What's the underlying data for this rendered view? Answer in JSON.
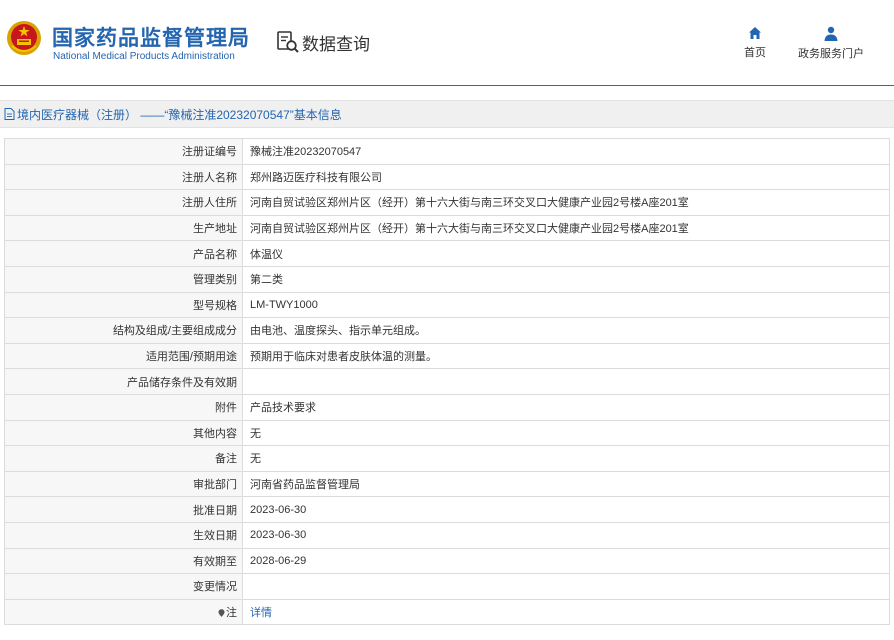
{
  "header": {
    "brand_cn": "国家药品监督管理局",
    "brand_en": "National Medical Products Administration",
    "query_label": "数据查询",
    "emblem_icon": "national-emblem-icon",
    "accent": "#2465b0",
    "nav": [
      {
        "label": "首页",
        "icon": "home-icon"
      },
      {
        "label": "政务服务门户",
        "icon": "user-icon"
      }
    ]
  },
  "title_bar": {
    "text": "境内医疗器械（注册） ——“豫械注准20232070547”基本信息"
  },
  "fields": [
    {
      "key": "注册证编号",
      "value": "豫械注准20232070547"
    },
    {
      "key": "注册人名称",
      "value": "郑州路迈医疗科技有限公司"
    },
    {
      "key": "注册人住所",
      "value": "河南自贸试验区郑州片区（经开）第十六大街与南三环交叉口大健康产业园2号楼A座201室"
    },
    {
      "key": "生产地址",
      "value": "河南自贸试验区郑州片区（经开）第十六大街与南三环交叉口大健康产业园2号楼A座201室"
    },
    {
      "key": "产品名称",
      "value": "体温仪"
    },
    {
      "key": "管理类别",
      "value": "第二类"
    },
    {
      "key": "型号规格",
      "value": "LM-TWY1000"
    },
    {
      "key": "结构及组成/主要组成成分",
      "value": "由电池、温度探头、指示单元组成。"
    },
    {
      "key": "适用范围/预期用途",
      "value": "预期用于临床对患者皮肤体温的测量。"
    },
    {
      "key": "产品储存条件及有效期",
      "value": ""
    },
    {
      "key": "附件",
      "value": "产品技术要求"
    },
    {
      "key": "其他内容",
      "value": "无"
    },
    {
      "key": "备注",
      "value": "无"
    },
    {
      "key": "审批部门",
      "value": "河南省药品监督管理局"
    },
    {
      "key": "批准日期",
      "value": "2023-06-30"
    },
    {
      "key": "生效日期",
      "value": "2023-06-30"
    },
    {
      "key": "有效期至",
      "value": "2028-06-29"
    },
    {
      "key": "变更情况",
      "value": ""
    }
  ],
  "note_row": {
    "key": "注",
    "link": "详情"
  }
}
